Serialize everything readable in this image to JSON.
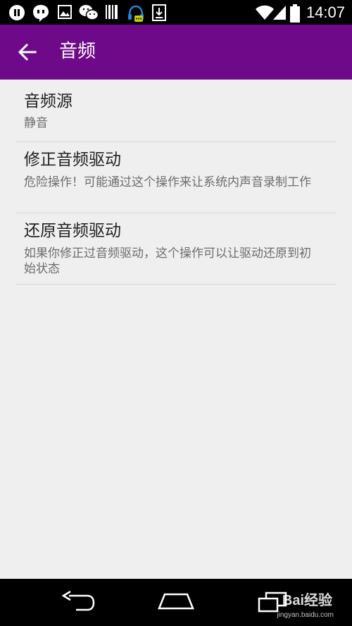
{
  "status_bar": {
    "time": "14:07",
    "icons": [
      "pause-icon",
      "chat-bubble-icon",
      "image-icon",
      "wechat-icon",
      "barcode-icon",
      "headset-icon",
      "download-icon",
      "wifi-icon",
      "signal-icon",
      "battery-icon"
    ]
  },
  "app_bar": {
    "title": "音频",
    "back_icon": "arrow-left-icon"
  },
  "preferences": [
    {
      "title": "音频源",
      "summary": "静音"
    },
    {
      "title": "修正音频驱动",
      "summary": "危险操作！可能通过这个操作来让系统内声音录制工作"
    },
    {
      "title": "还原音频驱动",
      "summary": "如果你修正过音频驱动，这个操作可以让驱动还原到初始状态"
    }
  ],
  "nav_bar": {
    "icons": [
      "back-nav-icon",
      "home-nav-icon",
      "recents-nav-icon"
    ]
  },
  "watermark": {
    "text": "Bai经验",
    "subtext": "jingyan.baidu.com"
  },
  "colors": {
    "app_bar": "#6e0a89",
    "background": "#efefef",
    "status_bar": "#000000"
  }
}
